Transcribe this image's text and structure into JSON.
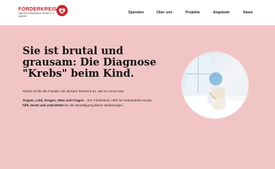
{
  "logo": {
    "title": "FÖRDERKREIS",
    "subtitle": "Hilfe für krebskranke Kinder e.V. Aachen",
    "emblem_icon": "heart-cross-emblem-icon",
    "accent": "#c8262b"
  },
  "nav": {
    "items": [
      {
        "label": "Spenden"
      },
      {
        "label": "Über uns"
      },
      {
        "label": "Projekte"
      },
      {
        "label": "Angebote"
      },
      {
        "label": "News"
      }
    ]
  },
  "hero": {
    "background": "#f1c5c6",
    "headline": "Sie ist brutal und grausam: Die Diagnose \"Krebs\" beim Kind.",
    "intro": "Nichts ist für die Familie von diesem Moment an, wie es zuvor war.",
    "paragraph": {
      "part1": "Ängste, Leid, Sorgen, Nöte und Fragen",
      "part2": "... Der Förderkreis Hilfe für krebskranke Kinder ",
      "part3": "hilft, berät und unterstützt",
      "part4": " bei der Bewältigung dieser Belastungen."
    },
    "image": "child-in-hospital-photo"
  }
}
